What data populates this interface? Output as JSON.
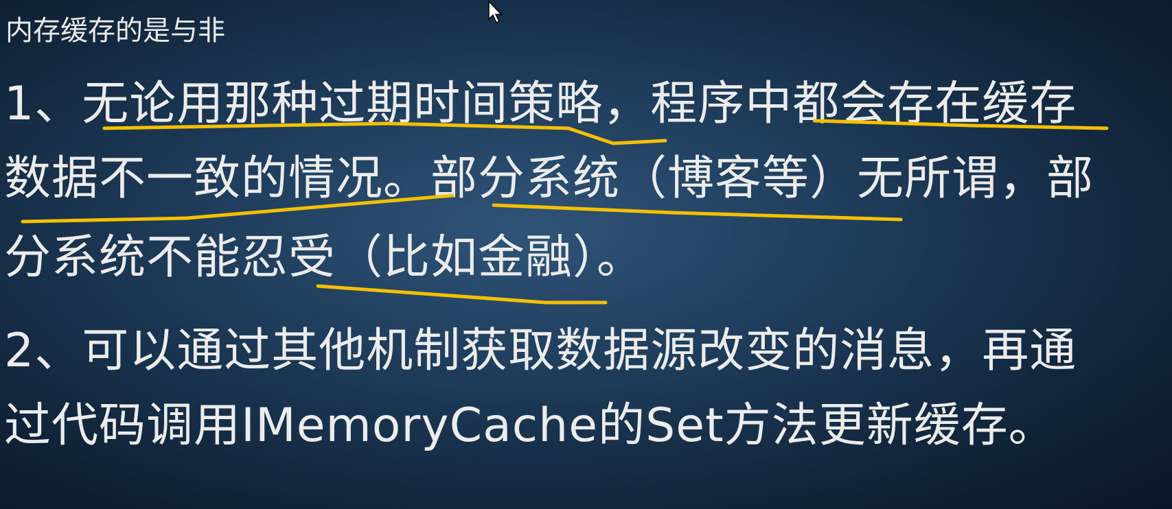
{
  "slide": {
    "title": "内存缓存的是与非",
    "lines": [
      "1、无论用那种过期时间策略，程序中都会存在缓存",
      "数据不一致的情况。部分系统（博客等）无所谓，部",
      "分系统不能忍受（比如金融）。",
      "2、可以通过其他机制获取数据源改变的消息，再通",
      "过代码调用IMemoryCache的Set方法更新缓存。"
    ]
  },
  "annotation_color": "#f5c000",
  "icons": {
    "cursor": "mouse-pointer-icon"
  }
}
